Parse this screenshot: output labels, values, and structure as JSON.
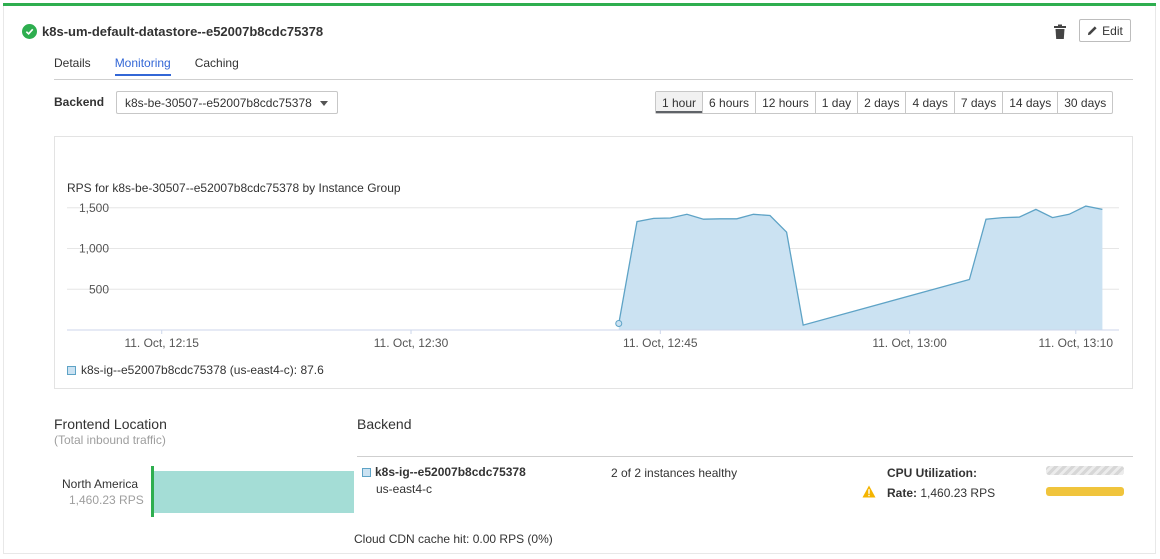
{
  "header": {
    "title": "k8s-um-default-datastore--e52007b8cdc75378",
    "edit_label": "Edit"
  },
  "tabs": [
    {
      "label": "Details",
      "active": false
    },
    {
      "label": "Monitoring",
      "active": true
    },
    {
      "label": "Caching",
      "active": false
    }
  ],
  "backend_selector": {
    "label": "Backend",
    "value": "k8s-be-30507--e52007b8cdc75378"
  },
  "time_ranges": [
    "1 hour",
    "6 hours",
    "12 hours",
    "1 day",
    "2 days",
    "4 days",
    "7 days",
    "14 days",
    "30 days"
  ],
  "time_range_selected": "1 hour",
  "chart_data": {
    "type": "area",
    "title": "RPS for k8s-be-30507--e52007b8cdc75378 by Instance Group",
    "xlabel": "",
    "ylabel": "",
    "y_ticks": [
      500,
      1000,
      1500
    ],
    "y_tick_labels": [
      "500",
      "1,000",
      "1,500"
    ],
    "ylim": [
      0,
      1620
    ],
    "x_tick_labels": [
      "11. Oct, 12:15",
      "11. Oct, 12:30",
      "11. Oct, 12:45",
      "11. Oct, 13:00",
      "11. Oct, 13:10"
    ],
    "x_tick_minutes": [
      15,
      30,
      45,
      60,
      70
    ],
    "xlim_minutes": [
      9.3,
      72.6
    ],
    "grid": true,
    "series": [
      {
        "name": "k8s-ig--e52007b8cdc75378 (us-east4-c)",
        "color": "#cbe2f2",
        "line_color": "#5ea3c6",
        "x_minutes": [
          42.5,
          43.6,
          44.6,
          45.6,
          46.6,
          47.6,
          48.6,
          49.6,
          50.6,
          51.6,
          52.6,
          53.6,
          63.6,
          64.6,
          65.6,
          66.6,
          67.6,
          68.6,
          69.6,
          70.6,
          71.6
        ],
        "y": [
          80,
          1330,
          1370,
          1375,
          1420,
          1360,
          1365,
          1365,
          1420,
          1405,
          1200,
          60,
          620,
          1360,
          1380,
          1385,
          1480,
          1380,
          1420,
          1520,
          1480
        ]
      }
    ],
    "legend": [
      {
        "label": "k8s-ig--e52007b8cdc75378 (us-east4-c): 87.6"
      }
    ],
    "legend_position": "bottom-left"
  },
  "frontend": {
    "title": "Frontend Location",
    "subtitle": "(Total inbound traffic)",
    "region": "North America",
    "rps": "1,460.23 RPS"
  },
  "backend": {
    "title": "Backend",
    "instance_group": "k8s-ig--e52007b8cdc75378",
    "zone": "us-east4-c",
    "health": "2 of 2 instances healthy",
    "cpu_label": "CPU Utilization:",
    "rate_label": "Rate:",
    "rate_value": "1,460.23 RPS",
    "cdn": "Cloud CDN cache hit: 0.00 RPS (0%)"
  },
  "colors": {
    "accent_green": "#2eae4f",
    "tab_active": "#3367d6",
    "area_fill": "#cbe2f2",
    "area_line": "#5ea3c6",
    "flow_fill": "#a4ddd6",
    "rate_bar": "#f0c43c",
    "warning": "#f4b400"
  },
  "icons": {
    "status": "check-circle-icon",
    "delete": "trash-icon",
    "edit": "pencil-icon",
    "warning": "warning-icon"
  }
}
